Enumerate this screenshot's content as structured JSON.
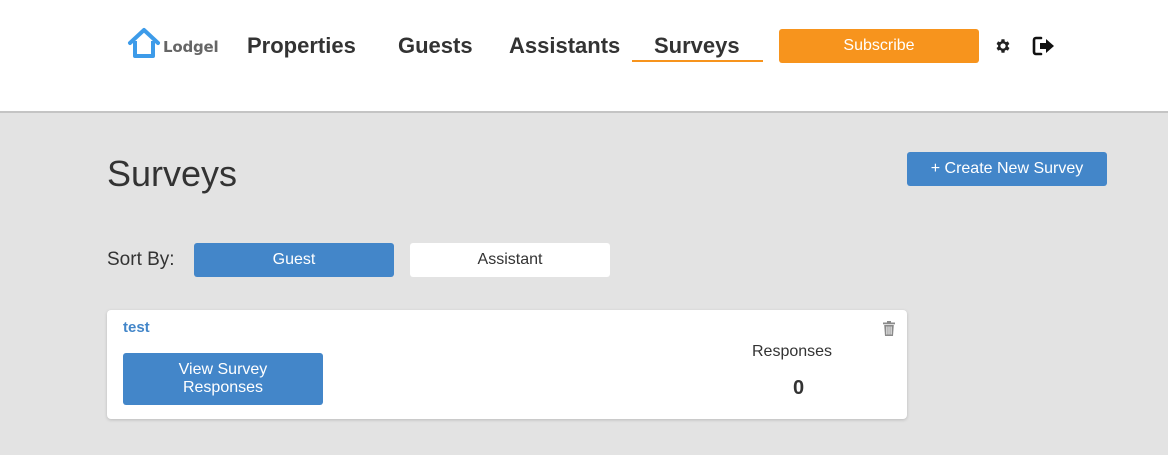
{
  "header": {
    "logo_text": "Lodgel",
    "nav": {
      "properties": "Properties",
      "guests": "Guests",
      "assistants": "Assistants",
      "surveys": "Surveys"
    },
    "active_nav": "surveys",
    "subscribe_label": "Subscribe",
    "icons": [
      "home-logo-icon",
      "gear-icon",
      "logout-icon"
    ]
  },
  "page": {
    "title": "Surveys",
    "create_label": "+ Create New Survey",
    "sort_label": "Sort By:",
    "sort_options": [
      "Guest",
      "Assistant"
    ],
    "sort_selected": "Guest"
  },
  "surveys": [
    {
      "title": "test",
      "view_label": "View Survey Responses",
      "responses_label": "Responses",
      "responses_count": "0"
    }
  ],
  "colors": {
    "accent_blue": "#4386c9",
    "accent_orange": "#f7941d",
    "background": "#e3e3e3",
    "text": "#333333"
  }
}
